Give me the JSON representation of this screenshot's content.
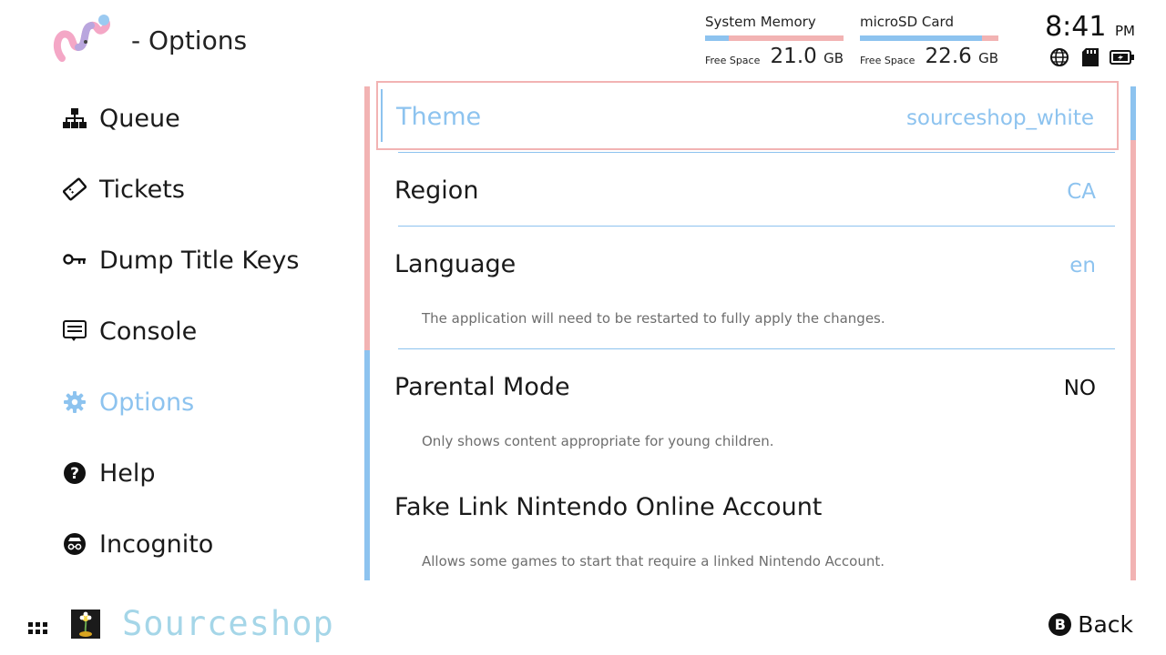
{
  "header": {
    "title": "- Options",
    "logo_icon": "wavy-creature-logo"
  },
  "storage": {
    "system": {
      "label": "System Memory",
      "free_label": "Free Space",
      "value": "21.0",
      "unit": "GB",
      "used_fraction": 0.17
    },
    "sd": {
      "label": "microSD Card",
      "free_label": "Free Space",
      "value": "22.6",
      "unit": "GB",
      "used_fraction": 0.88
    }
  },
  "clock": {
    "time": "8:41",
    "ampm": "PM"
  },
  "status_icons": [
    "globe-icon",
    "sd-card-icon",
    "battery-charging-icon"
  ],
  "sidebar": {
    "items": [
      {
        "label": "Queue",
        "icon": "hierarchy-icon"
      },
      {
        "label": "Tickets",
        "icon": "ticket-icon"
      },
      {
        "label": "Dump Title Keys",
        "icon": "key-icon"
      },
      {
        "label": "Console",
        "icon": "console-icon"
      },
      {
        "label": "Options",
        "icon": "gear-icon",
        "active": true
      },
      {
        "label": "Help",
        "icon": "help-icon"
      },
      {
        "label": "Incognito",
        "icon": "incognito-icon"
      }
    ]
  },
  "options": {
    "items": [
      {
        "label": "Theme",
        "value": "sourceshop_white",
        "focused": true
      },
      {
        "label": "Region",
        "value": "CA"
      },
      {
        "label": "Language",
        "value": "en",
        "description": "The application will need to be restarted to fully apply the changes."
      },
      {
        "label": "Parental Mode",
        "value": "NO",
        "description": "Only shows content appropriate for young children."
      },
      {
        "label": "Fake Link Nintendo Online Account",
        "value": "",
        "description": "Allows some games to start that require a linked Nintendo Account."
      }
    ]
  },
  "footer": {
    "brand": "Sourceshop",
    "back_button_glyph": "B",
    "back_label": "Back"
  },
  "colors": {
    "accent_blue": "#8dc3ef",
    "accent_pink": "#f2b3b3",
    "brand_text": "#a5d6e8"
  }
}
